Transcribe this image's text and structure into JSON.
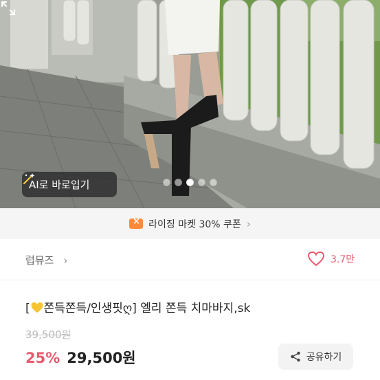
{
  "hero": {
    "ai_button_label": "AI로 바로입기",
    "carousel": {
      "total": 5,
      "active_index": 2
    }
  },
  "coupon": {
    "text": "라이징 마켓 30% 쿠폰"
  },
  "shop": {
    "name": "럽뮤즈",
    "likes": "3.7만"
  },
  "product": {
    "title_prefix": "[",
    "title_main": "쫀득쫀득/인생핏",
    "title_rest": "] 엘리 쫀득 치마바지,sk",
    "original_price": "39,500원",
    "discount": "25%",
    "price": "29,500원"
  },
  "actions": {
    "share_label": "공유하기"
  },
  "colors": {
    "accent": "#e85a6e",
    "coupon_icon": "#ff8a3d"
  }
}
